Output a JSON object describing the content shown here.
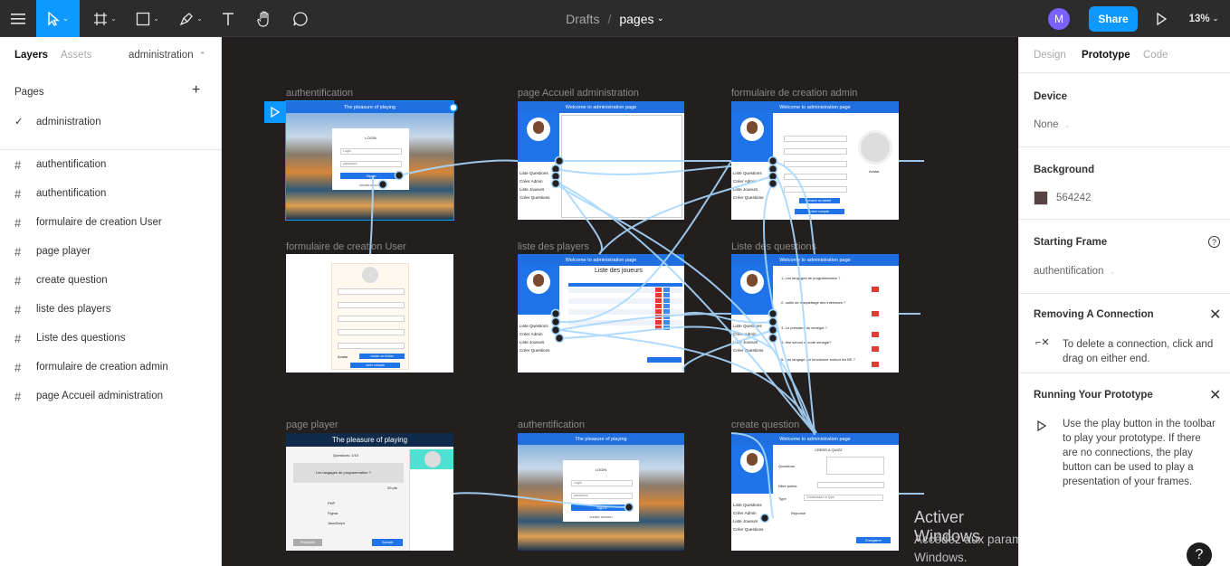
{
  "toolbar": {
    "breadcrumb_parent": "Drafts",
    "breadcrumb_sep": "/",
    "breadcrumb_current": "pages",
    "avatar_letter": "M",
    "share_label": "Share",
    "zoom": "13%"
  },
  "left_panel": {
    "tab_layers": "Layers",
    "tab_assets": "Assets",
    "page_selector": "administration",
    "pages_title": "Pages",
    "current_page": "administration",
    "layers": [
      "authentification",
      "authentification",
      "formulaire de creation User",
      "page player",
      "create question",
      "liste des players",
      "Liste des  questions",
      "formulaire de creation admin",
      "page Accueil administration"
    ]
  },
  "canvas": {
    "frames": {
      "auth1": "authentification",
      "accueil": "page Accueil administration",
      "form_admin": "formulaire de creation admin",
      "form_user": "formulaire de creation User",
      "liste_players": "liste des players",
      "liste_questions": "Liste des  questions",
      "player": "page player",
      "auth2": "authentification",
      "create_question": "create question"
    },
    "auth": {
      "header": "The pleasure of playing",
      "title": "LOGIN",
      "login_ph": "Login",
      "password_ph": "password",
      "signin": "Sign in",
      "create": "create accoun"
    },
    "admin_header": "Welcome to administration page",
    "menu": {
      "q": "Liste Questions",
      "admin": "Créer Admin",
      "players": "Liste Joueurs",
      "create_q": "Créer Questions"
    },
    "liste_joueurs_title": "Liste des joueurs",
    "avatar_label": "Avatar",
    "choisir_fichier": "choisir un fichier",
    "creer_compte": "créer compte",
    "player": {
      "questions": "Questions: 1/10",
      "question_text": "Les langages de programmation ?",
      "points": "20 pts",
      "options": [
        "PHP",
        "Figma",
        "JavaScript"
      ],
      "prev": "Précédent",
      "next": "Suivant"
    },
    "create_quizz": "CREER A QUIZZ",
    "questions_label": "Questions",
    "nbre_points": "Nbre points",
    "type_label": "Type",
    "type_select": "Choississez le type",
    "reponse_label": "Reponse",
    "enregistrer": "Enregistrer",
    "quiz_questions": [
      "1- Les langages de programmation ?",
      "2- outils de maquettage des interfaces ?",
      "3- Le président du senegal ?",
      "4- first school of code senegal?",
      "5- Les langage qui fonctionne surtout les BE ?"
    ]
  },
  "windows_watermark": {
    "line1": "Activer Windows",
    "line2": "Accédez aux paramètres de l'ordinateur pour activer Windows."
  },
  "right_panel": {
    "tab_design": "Design",
    "tab_prototype": "Prototype",
    "tab_code": "Code",
    "device_title": "Device",
    "device_value": "None",
    "background_title": "Background",
    "background_hex": "564242",
    "background_color": "#564242",
    "starting_frame_title": "Starting Frame",
    "starting_frame_value": "authentification",
    "removing_title": "Removing A Connection",
    "removing_desc": "To delete a connection, click and drag on either end.",
    "running_title": "Running Your Prototype",
    "running_desc": "Use the play button in the toolbar to play your prototype. If there are no connections, the play button can be used to play a presentation of your frames."
  },
  "colors": {
    "accent": "#0d99ff",
    "canvas_bg": "#231f1f",
    "connector": "#a8d8ff",
    "admin_blue": "#1e73e8"
  },
  "icons": [
    "menu-icon",
    "move-tool-icon",
    "frame-tool-icon",
    "shape-tool-icon",
    "pen-tool-icon",
    "text-tool-icon",
    "hand-tool-icon",
    "comment-tool-icon",
    "play-icon",
    "check-icon",
    "plus-icon",
    "close-icon",
    "help-icon",
    "disconnect-icon"
  ]
}
